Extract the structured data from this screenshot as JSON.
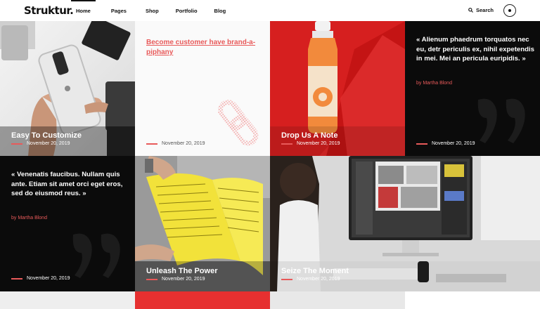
{
  "header": {
    "logo": "Struktur.",
    "nav": [
      "Home",
      "Pages",
      "Shop",
      "Portfolio",
      "Blog"
    ],
    "active_nav": "Home",
    "search_label": "Search"
  },
  "colors": {
    "accent": "#e85a5a",
    "red_tile": "#e52a2a",
    "dark_tile": "#0b0b0b"
  },
  "tiles": [
    {
      "type": "image-post",
      "image": "iphone-in-hand",
      "title": "Easy To Customize",
      "date": "November 20, 2019"
    },
    {
      "type": "link-post",
      "title": "Become customer have brand-a-piphany",
      "icon": "link-icon",
      "date": "November 20, 2019"
    },
    {
      "type": "image-post",
      "image": "juice-bottle",
      "title": "Drop Us A Note",
      "date": "November 20, 2019"
    },
    {
      "type": "quote-post",
      "quote": "« Alienum phaedrum torquatos nec eu, detr periculis ex, nihil expetendis in mei. Mei an pericula euripidis. »",
      "author": "by Martha Blond",
      "date": "November 20, 2019"
    },
    {
      "type": "quote-post",
      "quote": "« Venenatis faucibus. Nullam quis ante. Etiam sit amet orci eget eros, sed do eiusmod reus. »",
      "author": "by Martha Blond",
      "date": "November 20, 2019"
    },
    {
      "type": "image-post",
      "image": "yellow-book",
      "title": "Unleash The Power",
      "date": "November 20, 2019"
    },
    {
      "type": "image-post",
      "image": "designer-desk",
      "title": "Seize The Moment",
      "date": "November 20, 2019"
    }
  ]
}
